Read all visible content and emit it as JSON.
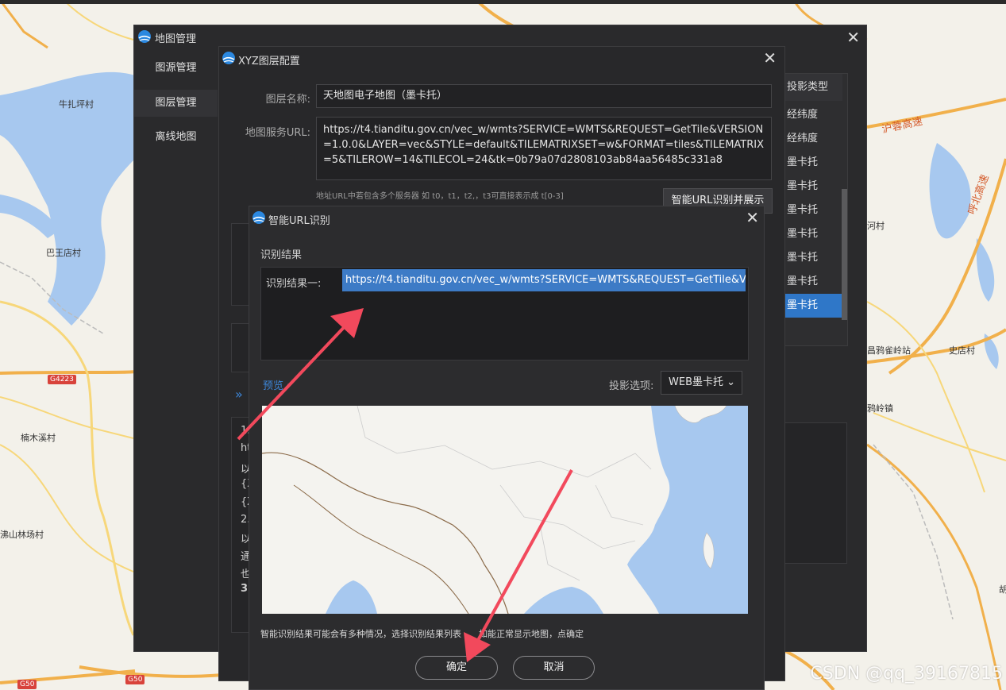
{
  "map": {
    "labels": [
      "牛扎坪村",
      "巴王店村",
      "楠木溪村",
      "沸山林场村",
      "史店村",
      "昌鸦雀岭站",
      "鸦岭镇",
      "河村",
      "胡"
    ],
    "roads": [
      "沪蓉高速",
      "呼北高速"
    ],
    "shields": [
      "G4223",
      "G50",
      "G50"
    ]
  },
  "main_window": {
    "title": "地图管理",
    "sidebar": [
      "图源管理",
      "图层管理",
      "离线地图"
    ],
    "grid_header": "投影类型",
    "grid_rows": [
      "经纬度",
      "经纬度",
      "墨卡托",
      "墨卡托",
      "墨卡托",
      "墨卡托",
      "墨卡托",
      "墨卡托",
      "墨卡托"
    ]
  },
  "xyz_window": {
    "title": "XYZ图层配置",
    "layer_name_label": "图层名称:",
    "layer_name_value": "天地图电子地图（墨卡托）",
    "service_url_label": "地图服务URL:",
    "service_url_value": "https://t4.tianditu.gov.cn/vec_w/wmts?SERVICE=WMTS&REQUEST=GetTile&VERSION=1.0.0&LAYER=vec&STYLE=default&TILEMATRIXSET=w&FORMAT=tiles&TILEMATRIX=5&TILEROW=14&TILECOL=24&tk=0b79a07d2808103ab84aa56485c331a8",
    "url_hint": "地址URL中若包含多个服务器 如 t0，t1，t2,，t3可直接表示成 t[0-3]",
    "smart_button": "智能URL识别并展示",
    "expand_icon": "»",
    "help_fragments": [
      "1.",
      "ht",
      "以",
      "{X",
      "{Z",
      "2.",
      "以",
      "通",
      "也",
      "3."
    ]
  },
  "url_dialog": {
    "title": "智能URL识别",
    "section": "识别结果",
    "result_label": "识别结果一:",
    "result_url": "https://t4.tianditu.gov.cn/vec_w/wmts?SERVICE=WMTS&REQUEST=GetTile&V...",
    "preview": "预览",
    "projection_label": "投影选项:",
    "projection_value": "WEB墨卡托",
    "note": "智能识别结果可能会有多种情况，选择识别结果列表　　如能正常显示地图，点确定",
    "ok": "确定",
    "cancel": "取消"
  },
  "watermark": "CSDN @qq_39167815",
  "colors": {
    "accent": "#3d7bc6",
    "arrow": "#f2495c",
    "dialog_bg": "#2c2c2e",
    "map_water": "#a7c8ef"
  }
}
